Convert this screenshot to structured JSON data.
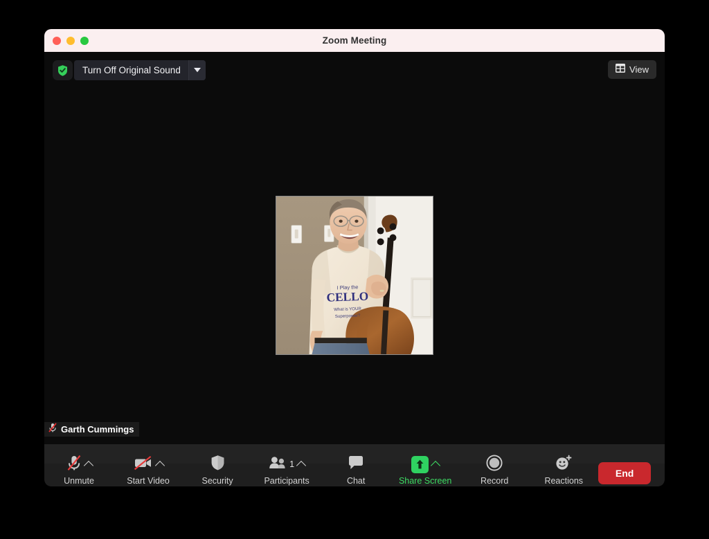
{
  "window": {
    "title": "Zoom Meeting",
    "traffic_lights": [
      {
        "name": "close",
        "color": "#ff5f57"
      },
      {
        "name": "minimize",
        "color": "#ffbd2e"
      },
      {
        "name": "maximize",
        "color": "#28c840"
      }
    ]
  },
  "stage": {
    "original_sound": {
      "shield_icon": "shield-check-icon",
      "label": "Turn Off Original Sound",
      "caret_icon": "caret-down-icon"
    },
    "view_button": {
      "icon": "layout-grid-icon",
      "label": "View"
    },
    "participant_tile": {
      "name": "Garth Cummings",
      "mic_icon": "microphone-muted-icon",
      "shirt_line1": "I Play the",
      "shirt_line2": "CELLO",
      "shirt_line3": "What is YOUR",
      "shirt_line4": "Superpower?"
    }
  },
  "toolbar": {
    "items": [
      {
        "key": "unmute",
        "label": "Unmute",
        "icon": "microphone-muted-icon",
        "chevron": true,
        "accent": "#d3d3d3"
      },
      {
        "key": "start-video",
        "label": "Start Video",
        "icon": "video-camera-muted-icon",
        "chevron": true,
        "accent": "#d3d3d3"
      },
      {
        "key": "security",
        "label": "Security",
        "icon": "shield-icon",
        "chevron": false,
        "accent": "#d3d3d3"
      },
      {
        "key": "participants",
        "label": "Participants",
        "icon": "people-icon",
        "chevron": true,
        "count": "1",
        "accent": "#d3d3d3"
      },
      {
        "key": "chat",
        "label": "Chat",
        "icon": "chat-bubble-icon",
        "chevron": false,
        "accent": "#d3d3d3"
      },
      {
        "key": "share-screen",
        "label": "Share Screen",
        "icon": "share-arrow-up-icon",
        "chevron": true,
        "accent": "#3ddc63"
      },
      {
        "key": "record",
        "label": "Record",
        "icon": "record-circle-icon",
        "chevron": false,
        "accent": "#d3d3d3"
      },
      {
        "key": "reactions",
        "label": "Reactions",
        "icon": "smiley-plus-icon",
        "chevron": false,
        "accent": "#d3d3d3"
      }
    ],
    "end_button": {
      "label": "End",
      "color": "#c9282d"
    }
  },
  "colors": {
    "titlebar_bg": "#fbeff0",
    "stage_bg": "#0b0b0b",
    "toolbar_bg": "#1f1f1f",
    "share_green": "#2fd261",
    "end_red": "#c9282d"
  }
}
